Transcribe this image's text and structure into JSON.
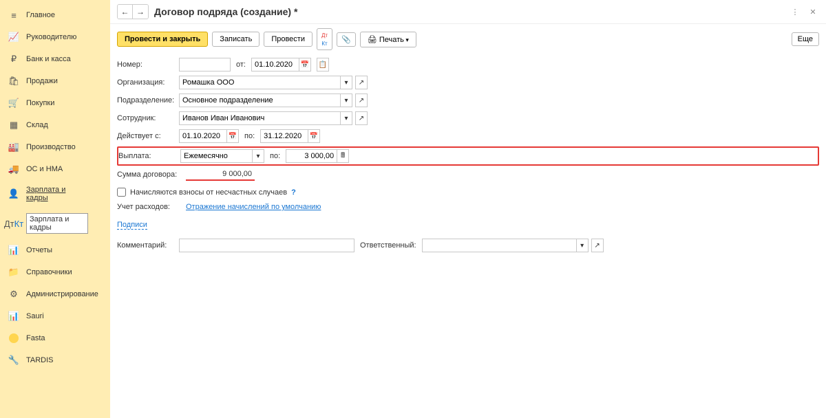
{
  "sidebar": {
    "items": [
      {
        "label": "Главное",
        "icon": "≡"
      },
      {
        "label": "Руководителю",
        "icon": "📈"
      },
      {
        "label": "Банк и касса",
        "icon": "₽"
      },
      {
        "label": "Продажи",
        "icon": "🛍"
      },
      {
        "label": "Покупки",
        "icon": "🛒"
      },
      {
        "label": "Склад",
        "icon": "▦"
      },
      {
        "label": "Производство",
        "icon": "🏭"
      },
      {
        "label": "ОС и НМА",
        "icon": "🚚"
      },
      {
        "label": "Зарплата и кадры",
        "icon": "👤"
      },
      {
        "label": "Зарплата и кадры",
        "icon": "Дт"
      },
      {
        "label": "Отчеты",
        "icon": "📊"
      },
      {
        "label": "Справочники",
        "icon": "📁"
      },
      {
        "label": "Администрирование",
        "icon": "⚙"
      },
      {
        "label": "Sauri",
        "icon": "📊"
      },
      {
        "label": "Fasta",
        "icon": "○"
      },
      {
        "label": "TARDIS",
        "icon": "🔧"
      }
    ]
  },
  "header": {
    "title": "Договор подряда (создание) *",
    "more_btn": "Еще"
  },
  "toolbar": {
    "post_close": "Провести и закрыть",
    "write": "Записать",
    "post": "Провести",
    "print": "Печать"
  },
  "form": {
    "number_label": "Номер:",
    "number_value": "",
    "from_label": "от:",
    "date_value": "01.10.2020",
    "org_label": "Организация:",
    "org_value": "Ромашка ООО",
    "dept_label": "Подразделение:",
    "dept_value": "Основное подразделение",
    "employee_label": "Сотрудник:",
    "employee_value": "Иванов Иван Иванович",
    "valid_from_label": "Действует с:",
    "valid_from": "01.10.2020",
    "to_label": "по:",
    "valid_to": "31.12.2020",
    "payment_label": "Выплата:",
    "payment_value": "Ежемесячно",
    "payment_to_label": "по:",
    "payment_amount": "3 000,00",
    "sum_label": "Сумма договора:",
    "sum_value": "9 000,00",
    "accident_checkbox": "Начисляются взносы от несчастных случаев",
    "expense_label": "Учет расходов:",
    "expense_link": "Отражение начислений по умолчанию",
    "signatures": "Подписи",
    "comment_label": "Комментарий:",
    "responsible_label": "Ответственный:"
  }
}
